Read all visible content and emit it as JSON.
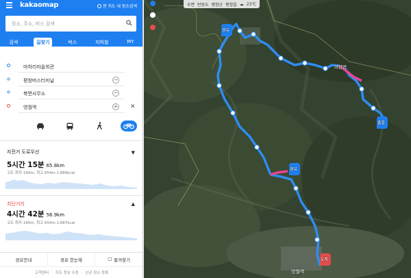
{
  "app": {
    "logo": "kakaomap",
    "map_search_label": "현 지도 내 장소검색"
  },
  "search": {
    "placeholder": "장소, 주소, 버스 검색"
  },
  "tabs": [
    "검색",
    "길찾기",
    "버스",
    "지하철",
    "MY"
  ],
  "active_tab": 1,
  "waypoints": [
    {
      "label": "마하리마을회관",
      "type": "start",
      "removable": false
    },
    {
      "label": "평창버스터미널",
      "type": "mid",
      "removable": true
    },
    {
      "label": "북면사무소",
      "type": "mid",
      "removable": true
    },
    {
      "label": "영월역",
      "type": "end",
      "removable": false,
      "add": true
    }
  ],
  "modes": [
    {
      "icon": "car-icon",
      "active": false
    },
    {
      "icon": "bus-icon",
      "active": false
    },
    {
      "icon": "walk-icon",
      "active": false
    },
    {
      "icon": "bike-icon",
      "active": true
    }
  ],
  "routes": [
    {
      "title": "자전거 도로우선",
      "arrow": "▼",
      "time": "5시간 15분",
      "distance": "65.8km",
      "detail": "고도 최저 190m, 최고 654m 1,889kcal",
      "title_color": "#333333"
    },
    {
      "title": "최단거리",
      "arrow": "▲",
      "time": "4시간 42분",
      "distance": "56.9km",
      "detail": "고도 최저 190m, 최고 654m 1,687kcal",
      "title_color": "#e24c4c"
    }
  ],
  "bottom_bar": [
    "경로안내",
    "경로 한눈에",
    "즐겨찾기"
  ],
  "footer": [
    "고객센터",
    "지도 정보 수정",
    "신규 장소 등록"
  ],
  "map": {
    "breadcrumb": [
      "수면",
      "턴동도",
      "평창군",
      "평창읍",
      "23℃"
    ],
    "labels": [
      "출발",
      "경유",
      "경유",
      "도착",
      "영월역"
    ],
    "place_label": "미탄면"
  },
  "colors": {
    "brand": "#1e7ff0",
    "route": "#2f8cf0",
    "climb": "#e8468e",
    "end": "#e24c4c"
  }
}
